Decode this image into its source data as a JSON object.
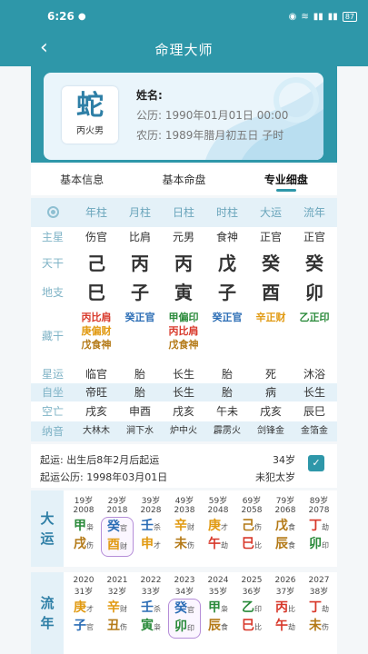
{
  "status": {
    "time": "6:26",
    "battery": "87"
  },
  "header": {
    "title": "命理大师"
  },
  "profile": {
    "zodiac": "蛇",
    "sub": "丙火男",
    "name_label": "姓名:",
    "solar": "公历: 1990年01月01日 00:00",
    "lunar": "农历: 1989年腊月初五日 子时"
  },
  "tabs": [
    "基本信息",
    "基本命盘",
    "专业细盘"
  ],
  "grid": {
    "headers": [
      "年柱",
      "月柱",
      "日柱",
      "时柱",
      "大运",
      "流年"
    ],
    "rows": {
      "main_star": {
        "label": "主星",
        "cells": [
          "伤官",
          "比肩",
          "元男",
          "食神",
          "正官",
          "正官"
        ]
      },
      "stem": {
        "label": "天干",
        "cells": [
          "己",
          "丙",
          "丙",
          "戊",
          "癸",
          "癸"
        ]
      },
      "branch": {
        "label": "地支",
        "cells": [
          "巳",
          "子",
          "寅",
          "子",
          "酉",
          "卯"
        ]
      },
      "hidden": {
        "label": "藏干",
        "cells": [
          [
            "丙比肩",
            "庚偏财",
            "戊食神"
          ],
          [
            "癸正官"
          ],
          [
            "甲偏印",
            "丙比肩",
            "戊食神"
          ],
          [
            "癸正官"
          ],
          [
            "辛正财"
          ],
          [
            "乙正印"
          ]
        ]
      },
      "star_fortune": {
        "label": "星运",
        "cells": [
          "临官",
          "胎",
          "长生",
          "胎",
          "死",
          "沐浴"
        ]
      },
      "self_seat": {
        "label": "自坐",
        "cells": [
          "帝旺",
          "胎",
          "长生",
          "胎",
          "病",
          "长生"
        ]
      },
      "void": {
        "label": "空亡",
        "cells": [
          "戌亥",
          "申酉",
          "戌亥",
          "午未",
          "戌亥",
          "辰巳"
        ]
      },
      "nayin": {
        "label": "纳音",
        "cells": [
          "大林木",
          "涧下水",
          "炉中火",
          "霹雳火",
          "剑锋金",
          "金箔金"
        ]
      }
    }
  },
  "start": {
    "line1": "起运: 出生后8年2月后起运",
    "line2": "起运公历: 1998年03月01日",
    "age": "34岁",
    "taisui": "未犯太岁"
  },
  "dayun": {
    "label": "大运",
    "cols": [
      {
        "age": "19岁",
        "year": "2008",
        "g": "甲",
        "gs": "枭",
        "z": "戌",
        "zs": "伤"
      },
      {
        "age": "29岁",
        "year": "2018",
        "g": "癸",
        "gs": "官",
        "z": "酉",
        "zs": "财"
      },
      {
        "age": "39岁",
        "year": "2028",
        "g": "壬",
        "gs": "杀",
        "z": "申",
        "zs": "才"
      },
      {
        "age": "49岁",
        "year": "2038",
        "g": "辛",
        "gs": "财",
        "z": "未",
        "zs": "伤"
      },
      {
        "age": "59岁",
        "year": "2048",
        "g": "庚",
        "gs": "才",
        "z": "午",
        "zs": "劫"
      },
      {
        "age": "69岁",
        "year": "2058",
        "g": "己",
        "gs": "伤",
        "z": "巳",
        "zs": "比"
      },
      {
        "age": "79岁",
        "year": "2068",
        "g": "戊",
        "gs": "食",
        "z": "辰",
        "zs": "食"
      },
      {
        "age": "89岁",
        "year": "2078",
        "g": "丁",
        "gs": "劫",
        "z": "卯",
        "zs": "印"
      }
    ]
  },
  "liunian": {
    "label": "流年",
    "cols": [
      {
        "year": "2020",
        "age": "31岁",
        "g": "庚",
        "gs": "才",
        "z": "子",
        "zs": "官"
      },
      {
        "year": "2021",
        "age": "32岁",
        "g": "辛",
        "gs": "财",
        "z": "丑",
        "zs": "伤"
      },
      {
        "year": "2022",
        "age": "33岁",
        "g": "壬",
        "gs": "杀",
        "z": "寅",
        "zs": "枭"
      },
      {
        "year": "2023",
        "age": "34岁",
        "g": "癸",
        "gs": "官",
        "z": "卯",
        "zs": "印"
      },
      {
        "year": "2024",
        "age": "35岁",
        "g": "甲",
        "gs": "枭",
        "z": "辰",
        "zs": "食"
      },
      {
        "year": "2025",
        "age": "36岁",
        "g": "乙",
        "gs": "印",
        "z": "巳",
        "zs": "比"
      },
      {
        "year": "2026",
        "age": "37岁",
        "g": "丙",
        "gs": "比",
        "z": "午",
        "zs": "劫"
      },
      {
        "year": "2027",
        "age": "38岁",
        "g": "丁",
        "gs": "劫",
        "z": "未",
        "zs": "伤"
      }
    ]
  },
  "colors": {
    "accent": "#2e97a9",
    "wood": "#2a8a3a",
    "fire": "#d8382a",
    "earth": "#b47a18",
    "metal": "#e19a12",
    "water": "#2b6db5"
  }
}
